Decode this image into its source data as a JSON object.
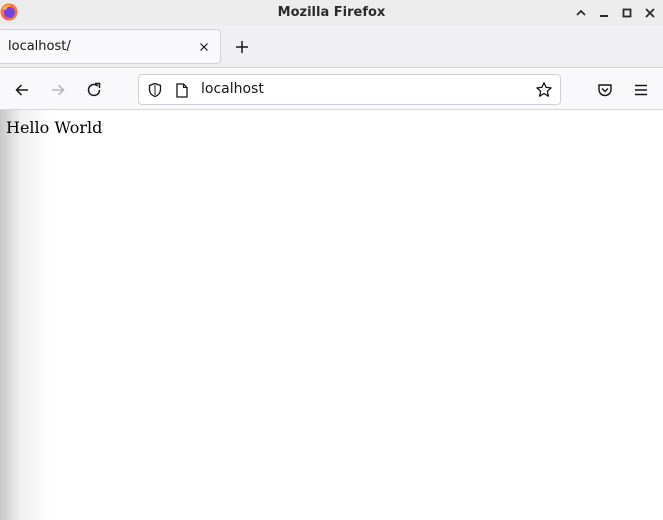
{
  "window": {
    "title": "Mozilla Firefox"
  },
  "tabs": [
    {
      "label": "localhost/",
      "active": true
    }
  ],
  "toolbar": {
    "url": "localhost"
  },
  "page": {
    "text": "Hello World"
  },
  "icons": {
    "app": "firefox-logo-icon",
    "minimize": "minimize-icon",
    "maximize": "maximize-icon",
    "close": "close-icon",
    "tab_close": "close-icon",
    "new_tab": "plus-icon",
    "back": "arrow-left-icon",
    "forward": "arrow-right-icon",
    "reload": "reload-icon",
    "tracking_protection": "shield-icon",
    "page_info": "page-icon",
    "bookmark": "star-icon",
    "pocket": "pocket-icon",
    "menu": "hamburger-menu-icon"
  },
  "colors": {
    "titlebar": "#ececec",
    "tabstrip": "#f0f0f4",
    "navbar": "#f9f9fb",
    "text": "#15141a",
    "disabled_icon": "#b4b4bb"
  }
}
